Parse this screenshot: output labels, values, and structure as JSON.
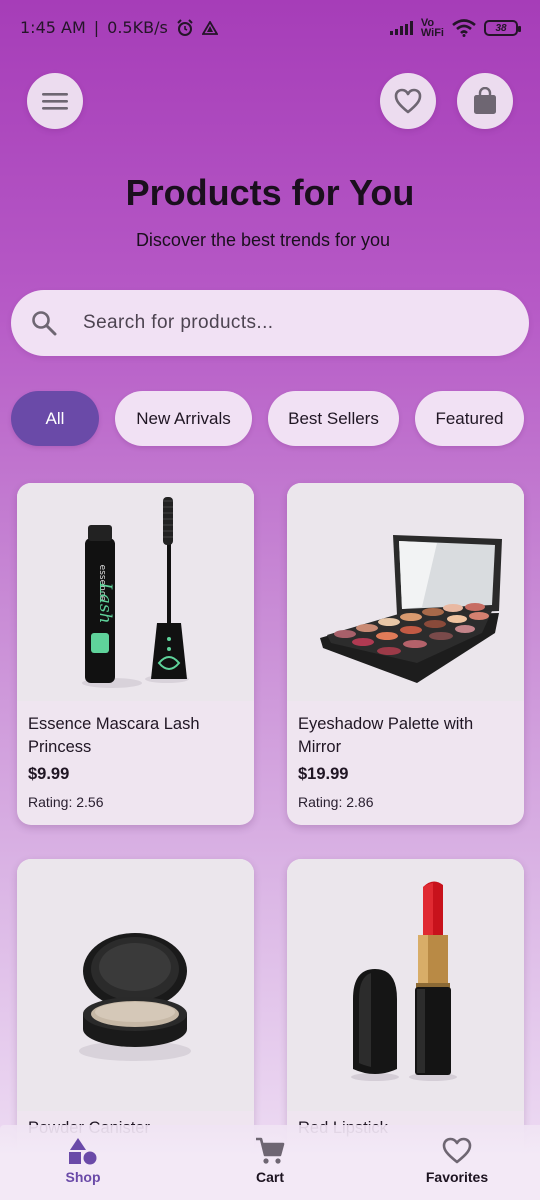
{
  "status_bar": {
    "time": "1:45 AM",
    "speed": "0.5KB/s",
    "network_label_top": "Vo",
    "network_label_bottom": "WiFi",
    "battery": "38"
  },
  "header": {
    "title": "Products for You",
    "subtitle": "Discover the best trends for you"
  },
  "search": {
    "placeholder": "Search for products..."
  },
  "filters": [
    {
      "label": "All",
      "active": true
    },
    {
      "label": "New Arrivals",
      "active": false
    },
    {
      "label": "Best Sellers",
      "active": false
    },
    {
      "label": "Featured",
      "active": false
    }
  ],
  "products": [
    {
      "name": "Essence Mascara Lash Princess",
      "price": "$9.99",
      "rating": "Rating: 2.56",
      "image": "mascara"
    },
    {
      "name": "Eyeshadow Palette with Mirror",
      "price": "$19.99",
      "rating": "Rating: 2.86",
      "image": "eyeshadow-palette"
    },
    {
      "name": "Powder Canister",
      "image": "powder-canister"
    },
    {
      "name": "Red Lipstick",
      "image": "red-lipstick"
    }
  ],
  "bottom_nav": [
    {
      "label": "Shop",
      "icon": "shapes-icon",
      "active": true
    },
    {
      "label": "Cart",
      "icon": "cart-icon",
      "active": false
    },
    {
      "label": "Favorites",
      "icon": "heart-icon",
      "active": false
    }
  ],
  "colors": {
    "accent": "#6a4aa8",
    "chip_bg": "#f1e1f4",
    "background_top": "#a63db8"
  }
}
